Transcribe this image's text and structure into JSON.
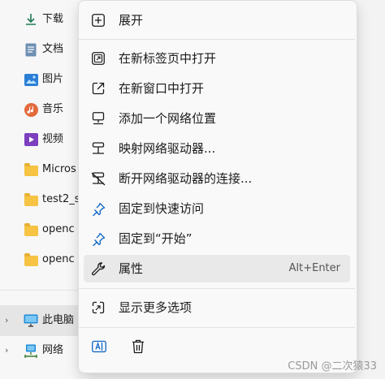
{
  "nav": {
    "items": [
      {
        "label": "下载",
        "icon": "download-icon"
      },
      {
        "label": "文档",
        "icon": "document-icon"
      },
      {
        "label": "图片",
        "icon": "pictures-icon"
      },
      {
        "label": "音乐",
        "icon": "music-icon"
      },
      {
        "label": "视频",
        "icon": "video-icon"
      },
      {
        "label": "Micros",
        "icon": "folder-icon"
      },
      {
        "label": "test2_s",
        "icon": "folder-icon"
      },
      {
        "label": "openc",
        "icon": "folder-icon"
      },
      {
        "label": "openc",
        "icon": "folder-icon"
      }
    ],
    "this_pc": {
      "label": "此电脑",
      "icon": "computer-icon",
      "chevron": "›"
    },
    "network": {
      "label": "网络",
      "icon": "network-icon",
      "chevron": "›"
    }
  },
  "menu": {
    "expand": "展开",
    "open_new_tab": "在新标签页中打开",
    "open_new_window": "在新窗口中打开",
    "add_network_location": "添加一个网络位置",
    "map_network_drive": "映射网络驱动器...",
    "disconnect_network_drive": "断开网络驱动器的连接...",
    "pin_quick_access": "固定到快速访问",
    "pin_start": "固定到“开始”",
    "properties": "属性",
    "properties_shortcut": "Alt+Enter",
    "show_more_options": "显示更多选项"
  },
  "colors": {
    "accent": "#0a64c8",
    "folder": "#f6c343",
    "menu_bg": "#f9f9f9",
    "hover_bg": "#e9e9e9"
  },
  "watermark": "CSDN @二次猿33"
}
